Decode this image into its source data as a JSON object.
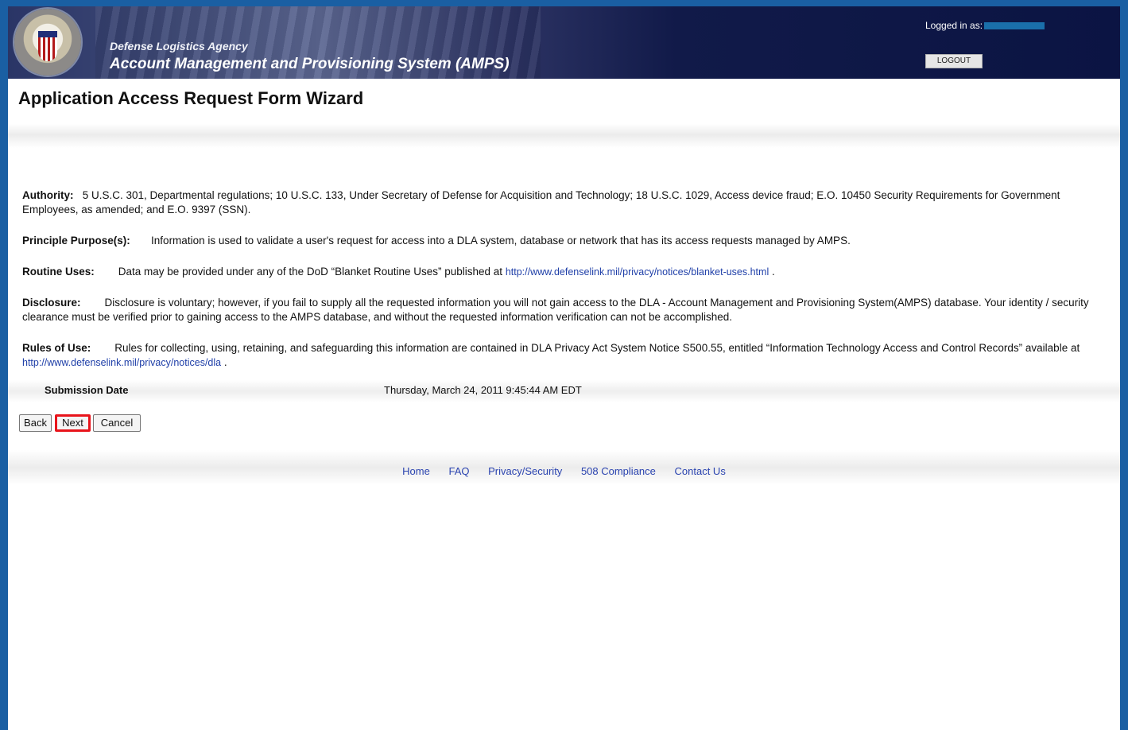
{
  "header": {
    "agency": "Defense Logistics Agency",
    "system": "Account Management and Provisioning System (AMPS)",
    "logged_in_label": "Logged in as:",
    "logout_label": "LOGOUT"
  },
  "page_title": "Application Access Request Form Wizard",
  "sections": {
    "authority": {
      "label": "Authority:",
      "text": "5 U.S.C. 301, Departmental regulations; 10 U.S.C. 133, Under Secretary of Defense for Acquisition and Technology; 18 U.S.C. 1029, Access device fraud; E.O. 10450 Security Requirements for Government Employees, as amended; and  E.O. 9397 (SSN)."
    },
    "purpose": {
      "label": "Principle Purpose(s):",
      "text": "Information is used to validate a user's request for access into a DLA system, database or network that has its access requests managed by AMPS."
    },
    "routine": {
      "label": "Routine Uses:",
      "text": "Data may be provided under any of the DoD “Blanket Routine Uses” published at",
      "link": "http://www.defenselink.mil/privacy/notices/blanket-uses.html",
      "after": "."
    },
    "disclosure": {
      "label": "Disclosure:",
      "text": "Disclosure is voluntary; however, if you fail to supply all the requested information you will not gain access to the DLA - Account Management and Provisioning System(AMPS) database. Your identity / security clearance must be verified prior to gaining access to the AMPS database, and without the requested information verification can not be accomplished."
    },
    "rules": {
      "label": "Rules of Use:",
      "text": "Rules for collecting, using, retaining, and safeguarding this information are contained in DLA Privacy Act System Notice S500.55, entitled “Information Technology Access and Control Records” available at",
      "link": "http://www.defenselink.mil/privacy/notices/dla",
      "after": "."
    }
  },
  "submission": {
    "label": "Submission Date",
    "value": "Thursday, March 24, 2011 9:45:44 AM EDT"
  },
  "buttons": {
    "back": "Back",
    "next": "Next",
    "cancel": "Cancel"
  },
  "footer": {
    "links": [
      "Home",
      "FAQ",
      "Privacy/Security",
      "508 Compliance",
      "Contact Us"
    ]
  },
  "colors": {
    "frame": "#1a5fa3",
    "banner": "#0b1443",
    "link": "#1f3fa8",
    "next_highlight": "#e8141b"
  }
}
